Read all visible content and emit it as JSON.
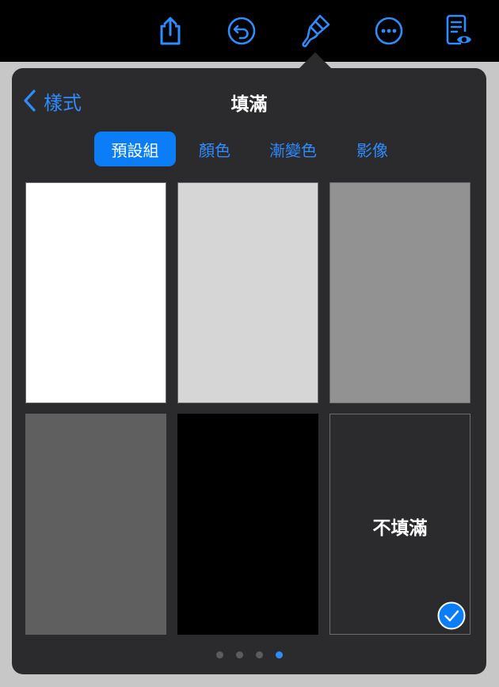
{
  "toolbar": {
    "icons": [
      "share-icon",
      "undo-icon",
      "paintbrush-icon",
      "more-icon",
      "reader-view-icon"
    ],
    "accent_color": "#2f8cff"
  },
  "popover": {
    "back_label": "樣式",
    "title": "填滿",
    "segments": [
      "預設組",
      "顏色",
      "漸變色",
      "影像"
    ],
    "active_segment": "預設組",
    "swatches": [
      {
        "color": "#ffffff"
      },
      {
        "color": "#d6d6d6"
      },
      {
        "color": "#929292"
      },
      {
        "color": "#5f5f5f"
      },
      {
        "color": "#000000"
      },
      {
        "color": "#2b2b2d",
        "label": "不填滿",
        "selected": true
      }
    ],
    "page_count": 4,
    "current_page": 4
  }
}
